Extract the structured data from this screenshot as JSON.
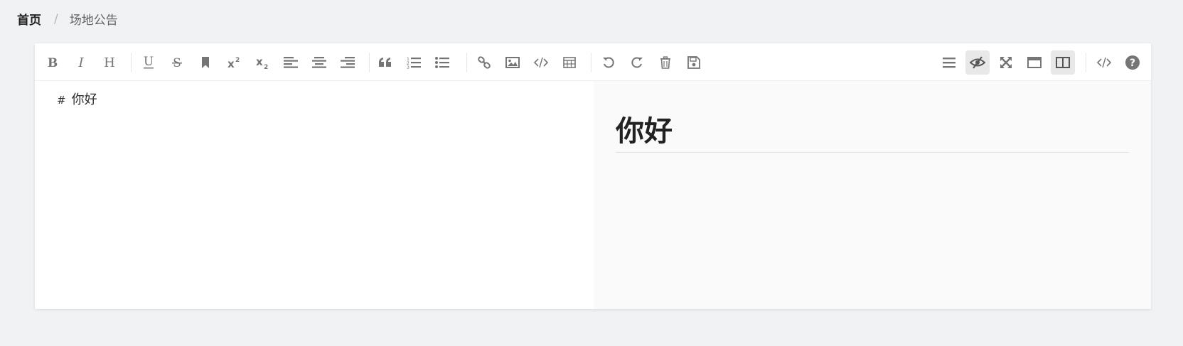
{
  "breadcrumb": {
    "home": "首页",
    "separator": "/",
    "current": "场地公告"
  },
  "toolbar": {
    "left": [
      {
        "name": "bold-button",
        "icon": "bold-icon"
      },
      {
        "name": "italic-button",
        "icon": "italic-icon"
      },
      {
        "name": "header-button",
        "icon": "header-icon"
      },
      {
        "name": "underline-button",
        "icon": "underline-icon"
      },
      {
        "name": "strikethrough-button",
        "icon": "strikethrough-icon"
      },
      {
        "name": "mark-button",
        "icon": "bookmark-icon"
      },
      {
        "name": "superscript-button",
        "icon": "superscript-icon"
      },
      {
        "name": "subscript-button",
        "icon": "subscript-icon"
      },
      {
        "name": "align-left-button",
        "icon": "align-left-icon"
      },
      {
        "name": "align-center-button",
        "icon": "align-center-icon"
      },
      {
        "name": "align-right-button",
        "icon": "align-right-icon"
      },
      {
        "name": "quote-button",
        "icon": "quote-icon"
      },
      {
        "name": "ordered-list-button",
        "icon": "ordered-list-icon"
      },
      {
        "name": "unordered-list-button",
        "icon": "unordered-list-icon"
      },
      {
        "name": "link-button",
        "icon": "link-icon"
      },
      {
        "name": "image-button",
        "icon": "image-icon"
      },
      {
        "name": "code-button",
        "icon": "code-icon"
      },
      {
        "name": "table-button",
        "icon": "table-icon"
      },
      {
        "name": "undo-button",
        "icon": "undo-icon"
      },
      {
        "name": "redo-button",
        "icon": "redo-icon"
      },
      {
        "name": "trash-button",
        "icon": "trash-icon"
      },
      {
        "name": "save-button",
        "icon": "save-icon"
      }
    ],
    "right": [
      {
        "name": "navigation-button",
        "icon": "bars-icon"
      },
      {
        "name": "preview-toggle-button",
        "icon": "eye-slash-icon",
        "active": true
      },
      {
        "name": "fullscreen-button",
        "icon": "expand-icon"
      },
      {
        "name": "read-mode-button",
        "icon": "window-icon"
      },
      {
        "name": "subfield-button",
        "icon": "columns-icon",
        "active": true
      },
      {
        "name": "html-code-button",
        "icon": "code-icon"
      },
      {
        "name": "help-button",
        "icon": "question-circle-icon"
      }
    ]
  },
  "editor": {
    "source_hash": "#",
    "source_text": "你好",
    "preview_heading": "你好"
  },
  "colors": {
    "icon": "#757575",
    "page_bg": "#f1f2f4",
    "preview_bg": "#fafafa"
  }
}
